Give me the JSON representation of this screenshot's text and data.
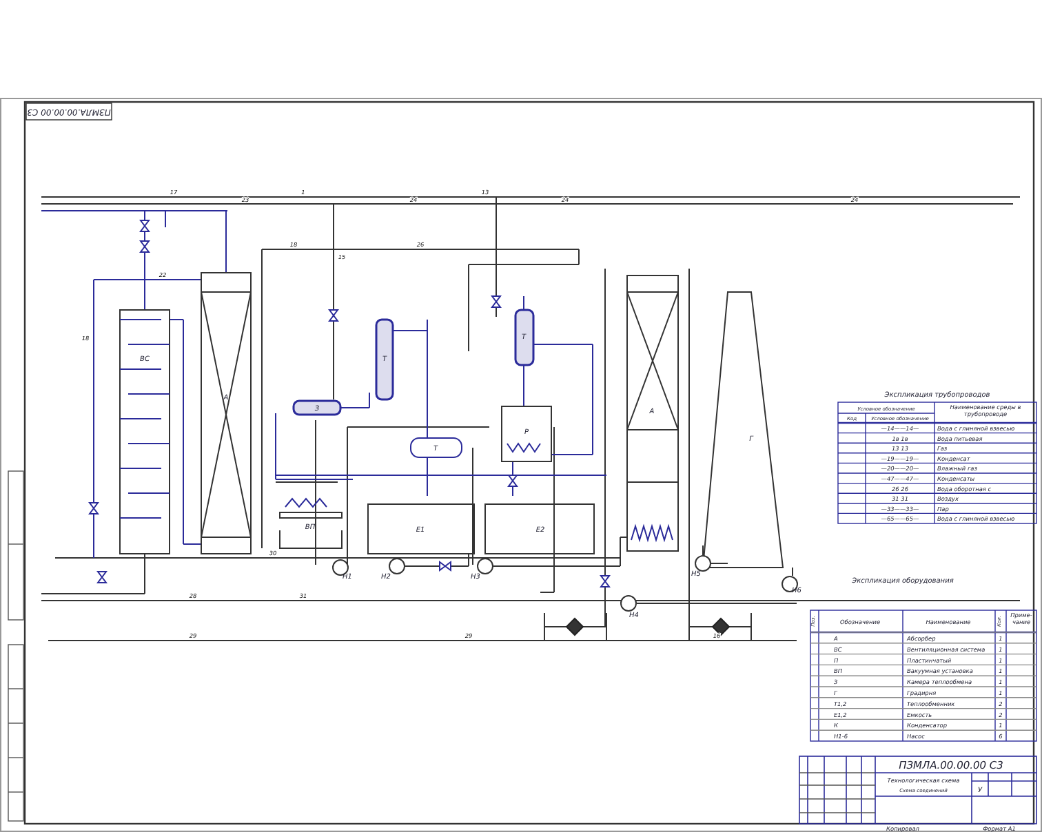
{
  "stamp": "ПЗМЛА.00.00.00 С3",
  "equipment_labels": [
    "ВС",
    "А",
    "З",
    "Т",
    "Т",
    "Р",
    "Т",
    "ВП",
    "Е1",
    "Е2",
    "А",
    "Г",
    "Н1",
    "Н2",
    "Н3",
    "Н4",
    "Н5",
    "Н6"
  ],
  "line_labels": [
    "17",
    "23",
    "1",
    "24",
    "24",
    "13",
    "24",
    "15",
    "18",
    "26",
    "22",
    "18",
    "30",
    "28",
    "29",
    "29",
    "31",
    "16"
  ],
  "pipe_legend": {
    "title": "Экспликация трубопроводов",
    "columns": [
      "Условное обозначение",
      "Код",
      "Условное обозначение",
      "Наименование среды в трубопроводе"
    ],
    "rows": [
      {
        "code": "—14——14—",
        "medium": "Вода с глиняной взвесью"
      },
      {
        "code": "1в     1в",
        "medium": "Вода питьевая"
      },
      {
        "code": "13     13",
        "medium": "Газ"
      },
      {
        "code": "—19——19—",
        "medium": "Конденсат"
      },
      {
        "code": "—20——20—",
        "medium": "Влажный газ"
      },
      {
        "code": "—47——47—",
        "medium": "Конденсаты"
      },
      {
        "code": "26     26",
        "medium": "Вода оборотная с "
      },
      {
        "code": "31     31",
        "medium": "Воздух"
      },
      {
        "code": "—33——33—",
        "medium": "Пар"
      },
      {
        "code": "—65——65—",
        "medium": "Вода с глиняной взвесью"
      }
    ]
  },
  "equipment_table": {
    "title": "Экспликация оборудования",
    "columns": [
      "Поз.",
      "Обозначение",
      "Наименование",
      "Кол.",
      "Приме-чание"
    ],
    "rows": [
      {
        "designation": "А",
        "name": "Абсорбер",
        "qty": "1"
      },
      {
        "designation": "ВС",
        "name": "Вентиляционная система",
        "qty": "1"
      },
      {
        "designation": "П",
        "name": "Пластинчатый",
        "qty": "1"
      },
      {
        "designation": "ВП",
        "name": "Вакуумная установка",
        "qty": "1"
      },
      {
        "designation": "З",
        "name": "Камера теплообмена",
        "qty": "1"
      },
      {
        "designation": "Г",
        "name": "Градирня",
        "qty": "1"
      },
      {
        "designation": "Т1,2",
        "name": "Теплообменник",
        "qty": "2"
      },
      {
        "designation": "Е1,2",
        "name": "Емкость",
        "qty": "2"
      },
      {
        "designation": "К",
        "name": "Конденсатор",
        "qty": "1"
      },
      {
        "designation": "Н1-6",
        "name": "Насос",
        "qty": "6"
      }
    ]
  },
  "title_block": {
    "document_code": "ПЗМЛА.00.00.00 С3",
    "title": "Технологическая схема",
    "subtitle": "Схема соединений",
    "letter": "У",
    "copied": "Копировал",
    "format": "Формат А1"
  }
}
